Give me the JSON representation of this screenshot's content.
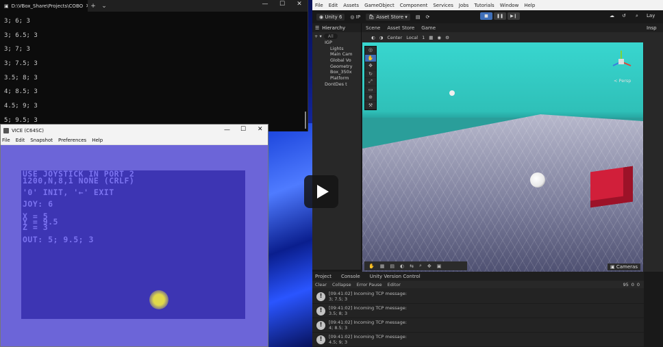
{
  "terminal": {
    "tab_title": "D:\\VBox_Share\\Projects\\COBO",
    "tab_close": "✕",
    "new_tab": "+",
    "dropdown": "⌄",
    "lines": [
      "3; 6; 3",
      "3; 6.5; 3",
      "3; 7; 3",
      "3; 7.5; 3",
      "3.5; 8; 3",
      "4; 8.5; 3",
      "4.5; 9; 3",
      "5; 9.5; 3"
    ],
    "ctrl_min": "—",
    "ctrl_max": "☐",
    "ctrl_close": "✕"
  },
  "vice": {
    "title": "VICE (C64SC)",
    "menu": [
      "File",
      "Edit",
      "Snapshot",
      "Preferences",
      "Help"
    ],
    "ctrl_min": "—",
    "ctrl_max": "☐",
    "ctrl_close": "✕",
    "screen": {
      "line1": "USE JOYSTICK IN PORT 2",
      "line2": "1200,N,8,1 NONE (CRLF)",
      "line3": "'0' INIT, '←' EXIT",
      "joy": "JOY: 6",
      "x": "X = 5",
      "y": "Y = 9.5",
      "z": "Z = 3",
      "out": "OUT: 5; 9.5; 3"
    }
  },
  "unity": {
    "menu": [
      "File",
      "Edit",
      "Assets",
      "GameObject",
      "Component",
      "Services",
      "Jobs",
      "Tutorials",
      "Window",
      "Help"
    ],
    "toolbar": {
      "brand": "Unity 6",
      "account": "IP",
      "asset_store": "Asset Store",
      "layers": "Lay"
    },
    "hierarchy": {
      "tab": "Hierarchy",
      "search_placeholder": "All",
      "items": [
        "IGP",
        "Lights",
        "Main Cam",
        "Global Vo",
        "Geometry",
        "Box_350x",
        "Platform",
        "DontDes t"
      ]
    },
    "scene": {
      "tabs": [
        "Scene",
        "Asset Store",
        "Game"
      ],
      "pivot": "Center",
      "space": "Local",
      "snap": "1",
      "persp": "< Persp",
      "cameras": "Cameras"
    },
    "inspector_tab": "Insp",
    "console": {
      "tabs": [
        "Project",
        "Console",
        "Unity Version Control"
      ],
      "toolbar": [
        "Clear",
        "Collapse",
        "Error Pause",
        "Editor"
      ],
      "counts": [
        "95",
        "0",
        "0"
      ],
      "entries": [
        {
          "time": "[09:41:02] Incoming TCP message:",
          "msg": "3; 7.5; 3"
        },
        {
          "time": "[09:41:02] Incoming TCP message:",
          "msg": "3.5; 8; 3"
        },
        {
          "time": "[09:41:02] Incoming TCP message:",
          "msg": "4; 8.5; 3"
        },
        {
          "time": "[09:41:02] Incoming TCP message:",
          "msg": "4.5; 9; 3"
        }
      ]
    }
  },
  "colors": {
    "c64_border": "#6c65d8",
    "c64_background": "#3d35b3",
    "c64_text": "#7b73f0",
    "cube": "#d11f3a",
    "unity_accent": "#3f6fb8"
  }
}
